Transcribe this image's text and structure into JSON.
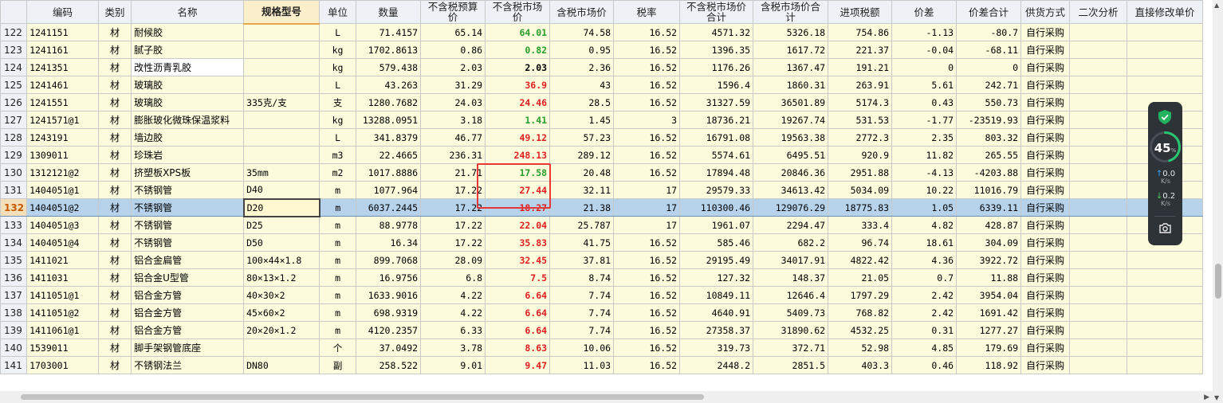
{
  "headers": [
    "",
    "编码",
    "类别",
    "名称",
    "规格型号",
    "单位",
    "数量",
    "不含税预算价",
    "不含税市场价",
    "含税市场价",
    "税率",
    "不含税市场价合计",
    "含税市场价合计",
    "进项税额",
    "价差",
    "价差合计",
    "供货方式",
    "二次分析",
    "直接修改单价"
  ],
  "rows": [
    {
      "rn": "122",
      "code": "1241151",
      "cat": "材",
      "name": "耐候胶",
      "spec": "",
      "unit": "L",
      "qty": "71.4157",
      "budget": "65.14",
      "market": "64.01",
      "mcolor": "green",
      "tax_market": "74.58",
      "rate": "16.52",
      "sum_ex": "4571.32",
      "sum_in": "5326.18",
      "input_tax": "754.86",
      "diff": "-1.13",
      "diff_sum": "-80.7",
      "supply": "自行采购",
      "white": false
    },
    {
      "rn": "123",
      "code": "1241161",
      "cat": "材",
      "name": "腻子胶",
      "spec": "",
      "unit": "kg",
      "qty": "1702.8613",
      "budget": "0.86",
      "market": "0.82",
      "mcolor": "green",
      "tax_market": "0.95",
      "rate": "16.52",
      "sum_ex": "1396.35",
      "sum_in": "1617.72",
      "input_tax": "221.37",
      "diff": "-0.04",
      "diff_sum": "-68.11",
      "supply": "自行采购",
      "white": false
    },
    {
      "rn": "124",
      "code": "1241351",
      "cat": "材",
      "name": "改性沥青乳胶",
      "spec": "",
      "unit": "kg",
      "qty": "579.438",
      "budget": "2.03",
      "market": "2.03",
      "mcolor": "black",
      "tax_market": "2.36",
      "rate": "16.52",
      "sum_ex": "1176.26",
      "sum_in": "1367.47",
      "input_tax": "191.21",
      "diff": "0",
      "diff_sum": "0",
      "supply": "自行采购",
      "white": true
    },
    {
      "rn": "125",
      "code": "1241461",
      "cat": "材",
      "name": "玻璃胶",
      "spec": "",
      "unit": "L",
      "qty": "43.263",
      "budget": "31.29",
      "market": "36.9",
      "mcolor": "red",
      "tax_market": "43",
      "rate": "16.52",
      "sum_ex": "1596.4",
      "sum_in": "1860.31",
      "input_tax": "263.91",
      "diff": "5.61",
      "diff_sum": "242.71",
      "supply": "自行采购",
      "white": false
    },
    {
      "rn": "126",
      "code": "1241551",
      "cat": "材",
      "name": "玻璃胶",
      "spec": "335克/支",
      "unit": "支",
      "qty": "1280.7682",
      "budget": "24.03",
      "market": "24.46",
      "mcolor": "red",
      "tax_market": "28.5",
      "rate": "16.52",
      "sum_ex": "31327.59",
      "sum_in": "36501.89",
      "input_tax": "5174.3",
      "diff": "0.43",
      "diff_sum": "550.73",
      "supply": "自行采购",
      "white": false
    },
    {
      "rn": "127",
      "code": "1241571@1",
      "cat": "材",
      "name": "膨胀玻化微珠保温浆料",
      "spec": "",
      "unit": "kg",
      "qty": "13288.0951",
      "budget": "3.18",
      "market": "1.41",
      "mcolor": "green",
      "tax_market": "1.45",
      "rate": "3",
      "sum_ex": "18736.21",
      "sum_in": "19267.74",
      "input_tax": "531.53",
      "diff": "-1.77",
      "diff_sum": "-23519.93",
      "supply": "自行采购",
      "white": false
    },
    {
      "rn": "128",
      "code": "1243191",
      "cat": "材",
      "name": "墙边胶",
      "spec": "",
      "unit": "L",
      "qty": "341.8379",
      "budget": "46.77",
      "market": "49.12",
      "mcolor": "red",
      "tax_market": "57.23",
      "rate": "16.52",
      "sum_ex": "16791.08",
      "sum_in": "19563.38",
      "input_tax": "2772.3",
      "diff": "2.35",
      "diff_sum": "803.32",
      "supply": "自行采购",
      "white": false
    },
    {
      "rn": "129",
      "code": "1309011",
      "cat": "材",
      "name": "珍珠岩",
      "spec": "",
      "unit": "m3",
      "qty": "22.4665",
      "budget": "236.31",
      "market": "248.13",
      "mcolor": "red",
      "tax_market": "289.12",
      "rate": "16.52",
      "sum_ex": "5574.61",
      "sum_in": "6495.51",
      "input_tax": "920.9",
      "diff": "11.82",
      "diff_sum": "265.55",
      "supply": "自行采购",
      "white": false
    },
    {
      "rn": "130",
      "code": "1312121@2",
      "cat": "材",
      "name": "挤塑板XPS板",
      "spec": "35mm",
      "unit": "m2",
      "qty": "1017.8886",
      "budget": "21.71",
      "market": "17.58",
      "mcolor": "green",
      "tax_market": "20.48",
      "rate": "16.52",
      "sum_ex": "17894.48",
      "sum_in": "20846.36",
      "input_tax": "2951.88",
      "diff": "-4.13",
      "diff_sum": "-4203.88",
      "supply": "自行采购",
      "white": false
    },
    {
      "rn": "131",
      "code": "1404051@1",
      "cat": "材",
      "name": "不锈钢管",
      "spec": "D40",
      "unit": "m",
      "qty": "1077.964",
      "budget": "17.22",
      "market": "27.44",
      "mcolor": "red",
      "tax_market": "32.11",
      "rate": "17",
      "sum_ex": "29579.33",
      "sum_in": "34613.42",
      "input_tax": "5034.09",
      "diff": "10.22",
      "diff_sum": "11016.79",
      "supply": "自行采购",
      "white": false
    },
    {
      "rn": "132",
      "code": "1404051@2",
      "cat": "材",
      "name": "不锈钢管",
      "spec": "D20",
      "unit": "m",
      "qty": "6037.2445",
      "budget": "17.22",
      "market": "18.27",
      "mcolor": "red",
      "tax_market": "21.38",
      "rate": "17",
      "sum_ex": "110300.46",
      "sum_in": "129076.29",
      "input_tax": "18775.83",
      "diff": "1.05",
      "diff_sum": "6339.11",
      "supply": "自行采购",
      "white": false,
      "selected": true
    },
    {
      "rn": "133",
      "code": "1404051@3",
      "cat": "材",
      "name": "不锈钢管",
      "spec": "D25",
      "unit": "m",
      "qty": "88.9778",
      "budget": "17.22",
      "market": "22.04",
      "mcolor": "red",
      "tax_market": "25.787",
      "rate": "17",
      "sum_ex": "1961.07",
      "sum_in": "2294.47",
      "input_tax": "333.4",
      "diff": "4.82",
      "diff_sum": "428.87",
      "supply": "自行采购",
      "white": false
    },
    {
      "rn": "134",
      "code": "1404051@4",
      "cat": "材",
      "name": "不锈钢管",
      "spec": "D50",
      "unit": "m",
      "qty": "16.34",
      "budget": "17.22",
      "market": "35.83",
      "mcolor": "red",
      "tax_market": "41.75",
      "rate": "16.52",
      "sum_ex": "585.46",
      "sum_in": "682.2",
      "input_tax": "96.74",
      "diff": "18.61",
      "diff_sum": "304.09",
      "supply": "自行采购",
      "white": false
    },
    {
      "rn": "135",
      "code": "1411021",
      "cat": "材",
      "name": "铝合金扁管",
      "spec": "100×44×1.8",
      "unit": "m",
      "qty": "899.7068",
      "budget": "28.09",
      "market": "32.45",
      "mcolor": "red",
      "tax_market": "37.81",
      "rate": "16.52",
      "sum_ex": "29195.49",
      "sum_in": "34017.91",
      "input_tax": "4822.42",
      "diff": "4.36",
      "diff_sum": "3922.72",
      "supply": "自行采购",
      "white": false
    },
    {
      "rn": "136",
      "code": "1411031",
      "cat": "材",
      "name": "铝合金U型管",
      "spec": "80×13×1.2",
      "unit": "m",
      "qty": "16.9756",
      "budget": "6.8",
      "market": "7.5",
      "mcolor": "red",
      "tax_market": "8.74",
      "rate": "16.52",
      "sum_ex": "127.32",
      "sum_in": "148.37",
      "input_tax": "21.05",
      "diff": "0.7",
      "diff_sum": "11.88",
      "supply": "自行采购",
      "white": false
    },
    {
      "rn": "137",
      "code": "1411051@1",
      "cat": "材",
      "name": "铝合金方管",
      "spec": "40×30×2",
      "unit": "m",
      "qty": "1633.9016",
      "budget": "4.22",
      "market": "6.64",
      "mcolor": "red",
      "tax_market": "7.74",
      "rate": "16.52",
      "sum_ex": "10849.11",
      "sum_in": "12646.4",
      "input_tax": "1797.29",
      "diff": "2.42",
      "diff_sum": "3954.04",
      "supply": "自行采购",
      "white": false
    },
    {
      "rn": "138",
      "code": "1411051@2",
      "cat": "材",
      "name": "铝合金方管",
      "spec": "45×60×2",
      "unit": "m",
      "qty": "698.9319",
      "budget": "4.22",
      "market": "6.64",
      "mcolor": "red",
      "tax_market": "7.74",
      "rate": "16.52",
      "sum_ex": "4640.91",
      "sum_in": "5409.73",
      "input_tax": "768.82",
      "diff": "2.42",
      "diff_sum": "1691.42",
      "supply": "自行采购",
      "white": false
    },
    {
      "rn": "139",
      "code": "1411061@1",
      "cat": "材",
      "name": "铝合金方管",
      "spec": "20×20×1.2",
      "unit": "m",
      "qty": "4120.2357",
      "budget": "6.33",
      "market": "6.64",
      "mcolor": "red",
      "tax_market": "7.74",
      "rate": "16.52",
      "sum_ex": "27358.37",
      "sum_in": "31890.62",
      "input_tax": "4532.25",
      "diff": "0.31",
      "diff_sum": "1277.27",
      "supply": "自行采购",
      "white": false
    },
    {
      "rn": "140",
      "code": "1539011",
      "cat": "材",
      "name": "脚手架钢管底座",
      "spec": "",
      "unit": "个",
      "qty": "37.0492",
      "budget": "3.78",
      "market": "8.63",
      "mcolor": "red",
      "tax_market": "10.06",
      "rate": "16.52",
      "sum_ex": "319.73",
      "sum_in": "372.71",
      "input_tax": "52.98",
      "diff": "4.85",
      "diff_sum": "179.69",
      "supply": "自行采购",
      "white": false
    },
    {
      "rn": "141",
      "code": "1703001",
      "cat": "材",
      "name": "不锈钢法兰",
      "spec": "DN80",
      "unit": "副",
      "qty": "258.522",
      "budget": "9.01",
      "market": "9.47",
      "mcolor": "red",
      "tax_market": "11.03",
      "rate": "16.52",
      "sum_ex": "2448.2",
      "sum_in": "2851.5",
      "input_tax": "403.3",
      "diff": "0.46",
      "diff_sum": "118.92",
      "supply": "自行采购",
      "white": false
    }
  ],
  "widget": {
    "cpu_percent": "45",
    "percent_sign": "%",
    "cpu_level": 0.45,
    "upload": "0.0",
    "upload_unit": "K/s",
    "download": "0.2",
    "download_unit": "K/s",
    "colors": {
      "shield": "#22b35e",
      "gauge": "#28c76f",
      "up": "#3ea6ff",
      "down": "#4fc35a",
      "bg": "#2e3338"
    },
    "icons": [
      "shield-check-icon",
      "up-arrow-icon",
      "down-arrow-icon",
      "camera-icon"
    ]
  }
}
